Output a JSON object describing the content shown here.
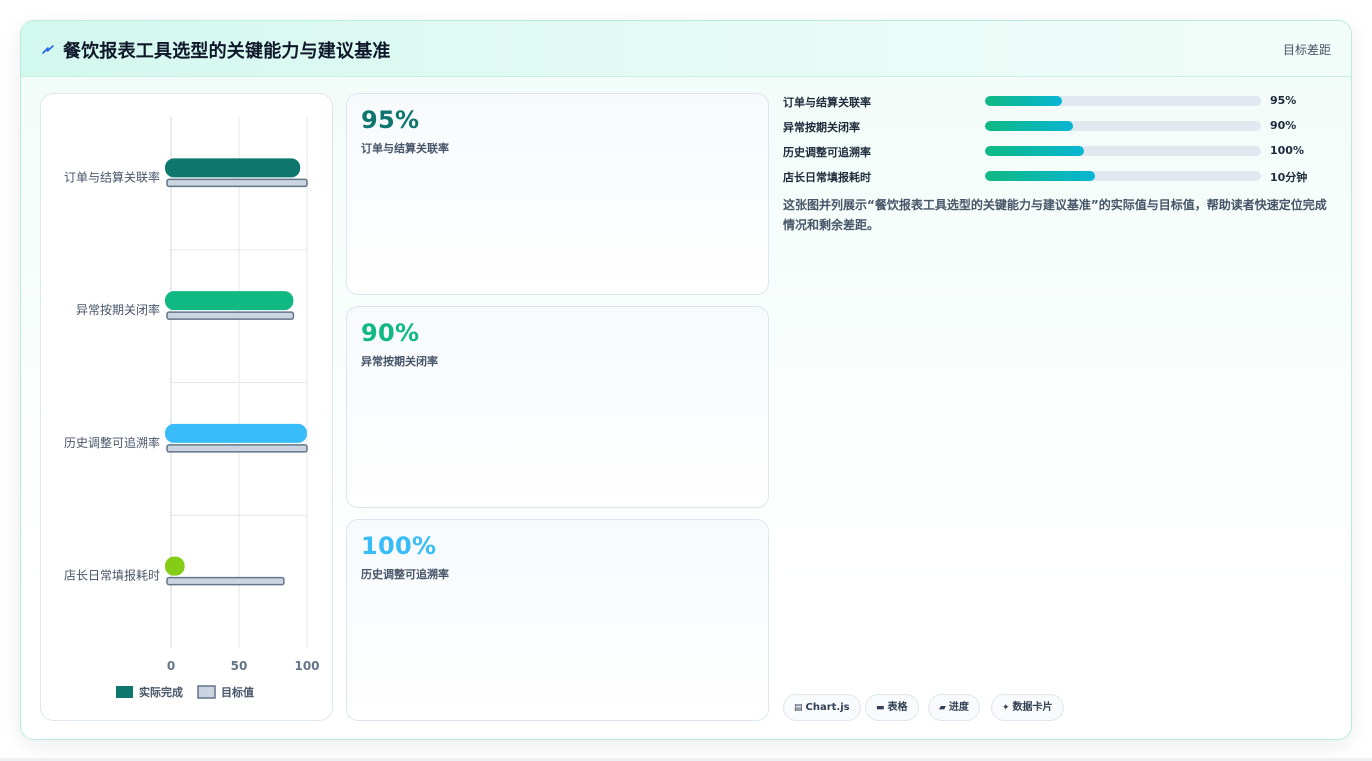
{
  "header": {
    "icon": "lightning-icon",
    "title": "餐饮报表工具选型的关键能力与建议基准",
    "right_label": "目标差距"
  },
  "chart_data": {
    "type": "bar",
    "orientation": "horizontal",
    "categories": [
      "订单与结算关联率",
      "异常按期关闭率",
      "历史调整可追溯率",
      "店长日常填报耗时"
    ],
    "series": [
      {
        "name": "实际完成",
        "values": [
          95,
          90,
          100,
          10
        ],
        "colors": [
          "#0f766e",
          "#10b981",
          "#38bdf8",
          "#84cc16"
        ]
      },
      {
        "name": "目标值",
        "values": [
          100,
          90,
          100,
          83
        ],
        "color": "#cbd5e1",
        "border": "#64748b"
      }
    ],
    "xlim": [
      0,
      100
    ],
    "xticks": [
      0,
      50,
      100
    ],
    "grid": true,
    "legend": "bottom"
  },
  "stats": [
    {
      "value": "95%",
      "label": "订单与结算关联率",
      "color": "#0f766e"
    },
    {
      "value": "90%",
      "label": "异常按期关闭率",
      "color": "#10b981"
    },
    {
      "value": "100%",
      "label": "历史调整可追溯率",
      "color": "#38bdf8"
    }
  ],
  "progress": [
    {
      "label": "订单与结算关联率",
      "fill": 0.28,
      "value": "95%"
    },
    {
      "label": "异常按期关闭率",
      "fill": 0.32,
      "value": "90%"
    },
    {
      "label": "历史调整可追溯率",
      "fill": 0.36,
      "value": "100%"
    },
    {
      "label": "店长日常填报耗时",
      "fill": 0.4,
      "value": "10分钟"
    }
  ],
  "description": "这张图并列展示“餐饮报表工具选型的关键能力与建议基准”的实际值与目标值，帮助读者快速定位完成情况和剩余差距。",
  "tags": [
    {
      "icon": "chart-icon",
      "label": "Chart.js"
    },
    {
      "icon": "table-icon",
      "label": "表格"
    },
    {
      "icon": "progress-icon",
      "label": "进度"
    },
    {
      "icon": "sparkle-icon",
      "label": "数据卡片"
    }
  ]
}
